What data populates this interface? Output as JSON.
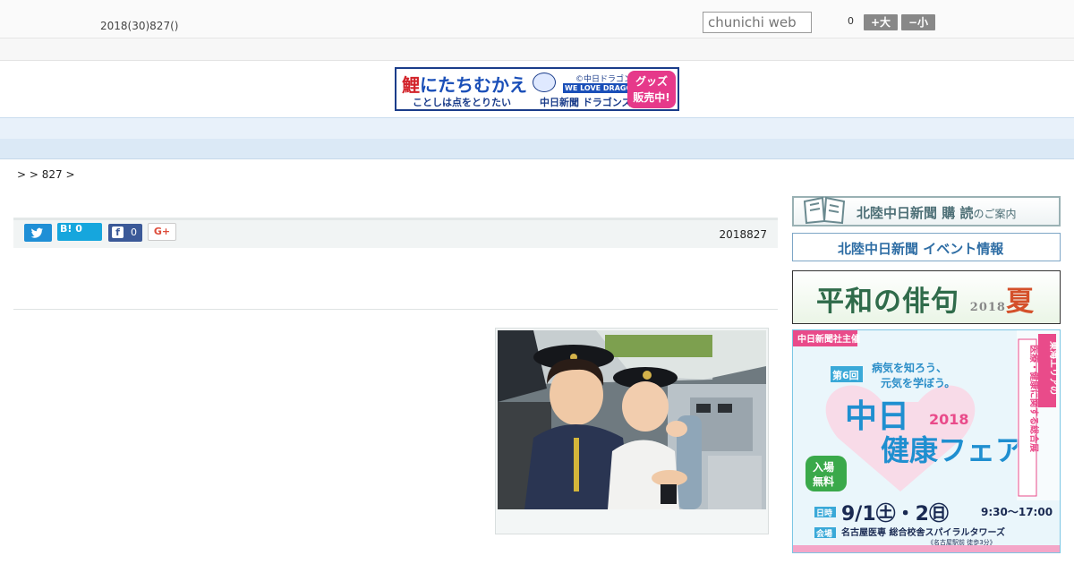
{
  "header": {
    "date": "2018(30)827()",
    "search_placeholder": "chunichi web",
    "count": "0",
    "font_bigger": "+大",
    "font_smaller": "−小"
  },
  "banner": {
    "headline_red": "鯉",
    "headline": "にたちむかえ",
    "subline": "ことしは点をとりたい",
    "shop": "中日新聞 ドラゴンズショップ",
    "copyright": "©中日ドラゴンズ",
    "slogan": "WE LOVE DRAGONS",
    "goods_line1": "グッズ",
    "goods_line2": "販売中!"
  },
  "nav": {
    "items": [
      "",
      "",
      "",
      "",
      "",
      "",
      "",
      "",
      ""
    ]
  },
  "breadcrumb": ">  > 827 >",
  "share": {
    "hatena_label": "B!",
    "hatena_count": "0",
    "facebook_count": "0",
    "googleplus_label": "G+",
    "date": "2018827"
  },
  "sidebar": {
    "subscribe_main": "北陸中日新聞 購 読",
    "subscribe_small": "のご案内",
    "event": "北陸中日新聞 イベント情報",
    "haiku_main": "平和の俳句",
    "haiku_year": "2018",
    "haiku_season": "夏",
    "fair": {
      "sponsor": "中日新聞社主催",
      "edition": "第6回",
      "slogan1": "病気を知ろう、",
      "slogan2": "元気を学ぼう。",
      "title1": "中日",
      "title2": "健康フェア",
      "year": "2018",
      "side_text1": "東海エリアの",
      "side_text2": "医療・健康に関する総合展",
      "free1": "入場",
      "free2": "無料",
      "date_label": "日時",
      "date": "9/1㊏・2㊐",
      "time": "9:30〜17:00",
      "venue_label": "会場",
      "venue": "名古屋医専 総合校舎スパイラルタワーズ",
      "access": "《名古屋駅前 徒歩3分》"
    }
  },
  "colors": {
    "nav_bg": "#e8f1fa",
    "facebook": "#3b5998",
    "twitter": "#1f8fd6",
    "hatena": "#16a6dd",
    "googleplus": "#dd4b39"
  }
}
